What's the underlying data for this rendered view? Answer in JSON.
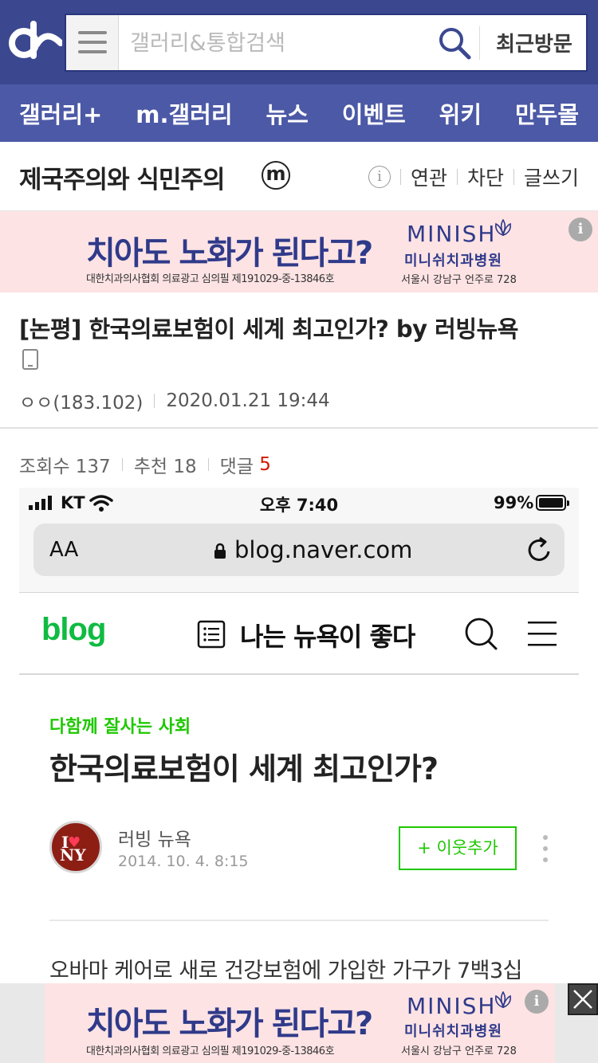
{
  "header": {
    "search_placeholder": "갤러리&통합검색",
    "recent_label": "최근방문"
  },
  "nav": {
    "items": [
      "갤러리+",
      "m.갤러리",
      "뉴스",
      "이벤트",
      "위키",
      "만두몰"
    ]
  },
  "gallery": {
    "title": "제국주의와 식민주의",
    "badge": "m",
    "actions": [
      "연관",
      "차단",
      "글쓰기"
    ]
  },
  "ad": {
    "headline": "치아도 노화가 된다고?",
    "sub": "대한치과의사협회 의료광고 심의필 제191029-중-13846호",
    "brand": "MINISH",
    "brand_ko": "미니쉬치과병원",
    "address": "서울시 강남구 언주로 728",
    "info": "i"
  },
  "post": {
    "title": "[논평] 한국의료보험이 세계 최고인가? by 러빙뉴욕",
    "author": "ㅇㅇ(183.102)",
    "date": "2020.01.21 19:44",
    "views_label": "조회수 137",
    "recommend_label": "추천 18",
    "comments_label": "댓글",
    "comments_count": "5"
  },
  "screenshot": {
    "carrier": "KT",
    "time": "오후 7:40",
    "battery": "99%",
    "aa": "AA",
    "url": "blog.naver.com",
    "blog_logo": "blog",
    "blog_name": "나는 뉴욕이 좋다",
    "category": "다함께 잘사는 사회",
    "title": "한국의료보험이 세계 최고인가?",
    "author": "러빙 뉴욕",
    "date": "2014. 10. 4. 8:15",
    "neighbor_button": "+ 이웃추가",
    "body": "오바마 케어로 새로 건강보험에 가입한 가구가 7백3십"
  },
  "colors": {
    "topbar": "#3b4890",
    "catnav": "#4c59a6",
    "ad_bg": "#fde3e4",
    "naver_green": "#1ec800",
    "comment_red": "#d31900"
  }
}
